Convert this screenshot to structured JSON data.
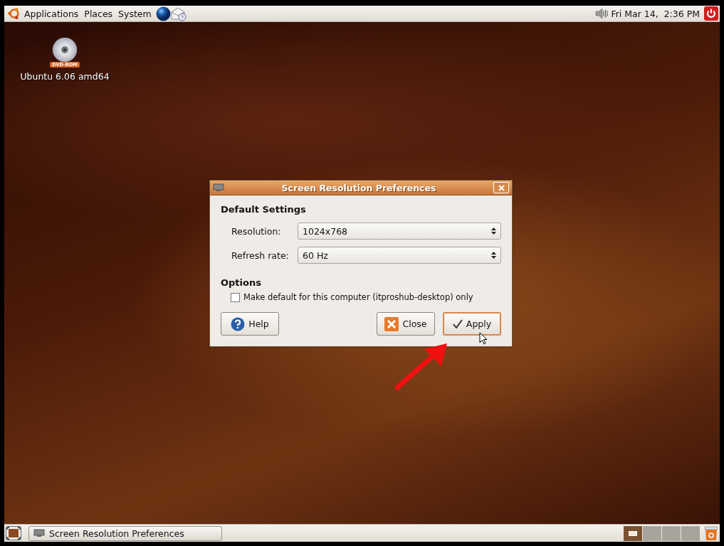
{
  "top_panel": {
    "menus": [
      {
        "label": "Applications"
      },
      {
        "label": "Places"
      },
      {
        "label": "System"
      }
    ],
    "clock": "Fri Mar 14,  2:36 PM"
  },
  "desktop_icons": [
    {
      "label": "Ubuntu 6.06 amd64",
      "badge": "DVD-ROM"
    }
  ],
  "dialog": {
    "title": "Screen Resolution Preferences",
    "default_settings": {
      "heading": "Default Settings",
      "fields": [
        {
          "label": "Resolution:",
          "value": "1024x768"
        },
        {
          "label": "Refresh rate:",
          "value": "60 Hz"
        }
      ]
    },
    "options": {
      "heading": "Options",
      "checkbox": {
        "label": "Make default for this computer (itproshub-desktop) only",
        "checked": false
      }
    },
    "buttons": [
      {
        "label": "Help",
        "kind": "help",
        "focused": false
      },
      {
        "label": "Close",
        "kind": "close",
        "focused": false
      },
      {
        "label": "Apply",
        "kind": "apply",
        "focused": true
      }
    ]
  },
  "bottom_panel": {
    "tasks": [
      {
        "label": "Screen Resolution Preferences",
        "selected": false
      }
    ],
    "workspaces": [
      {
        "selected": true
      },
      {
        "selected": false
      },
      {
        "selected": false
      },
      {
        "selected": false
      }
    ]
  }
}
